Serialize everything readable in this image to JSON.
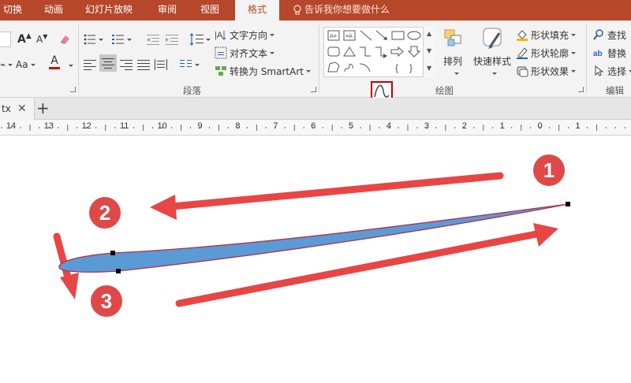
{
  "tabs": [
    {
      "label": "切换",
      "active": false
    },
    {
      "label": "动画",
      "active": false
    },
    {
      "label": "幻灯片放映",
      "active": false
    },
    {
      "label": "审阅",
      "active": false
    },
    {
      "label": "视图",
      "active": false
    },
    {
      "label": "格式",
      "active": true
    }
  ],
  "tell_me": {
    "text": "告诉我你想要做什么"
  },
  "ribbon": {
    "paragraph": {
      "text_direction": "文字方向",
      "align_text": "对齐文本",
      "convert_smartart": "转换为 SmartArt",
      "group_label": "段落"
    },
    "font": {
      "font_size_increase": "A",
      "font_size_decrease": "A",
      "case": "Aa",
      "font_color": "A"
    },
    "drawing": {
      "arrange": "排列",
      "quick_styles": "快速样式",
      "shape_fill": "形状填充",
      "shape_outline": "形状轮廓",
      "shape_effects": "形状效果",
      "group_label": "绘图"
    },
    "editing": {
      "find": "查找",
      "replace": "替换",
      "select": "选择",
      "group_label": "编辑"
    }
  },
  "document_tab": {
    "name": "tx"
  },
  "ruler": {
    "numbers": [
      "14",
      "13",
      "12",
      "11",
      "10",
      "9",
      "8",
      "7",
      "6",
      "5",
      "4",
      "3",
      "2",
      "1",
      "0",
      "1"
    ]
  },
  "annotations": [
    {
      "number": "1"
    },
    {
      "number": "2"
    },
    {
      "number": "3"
    }
  ],
  "colors": {
    "tabbar": "#b7472a",
    "shape_fill": "#5b9bd5",
    "shape_outline": "#b03050",
    "arrow": "#e84545",
    "badge": "#e04848",
    "highlight": "#c00000"
  }
}
